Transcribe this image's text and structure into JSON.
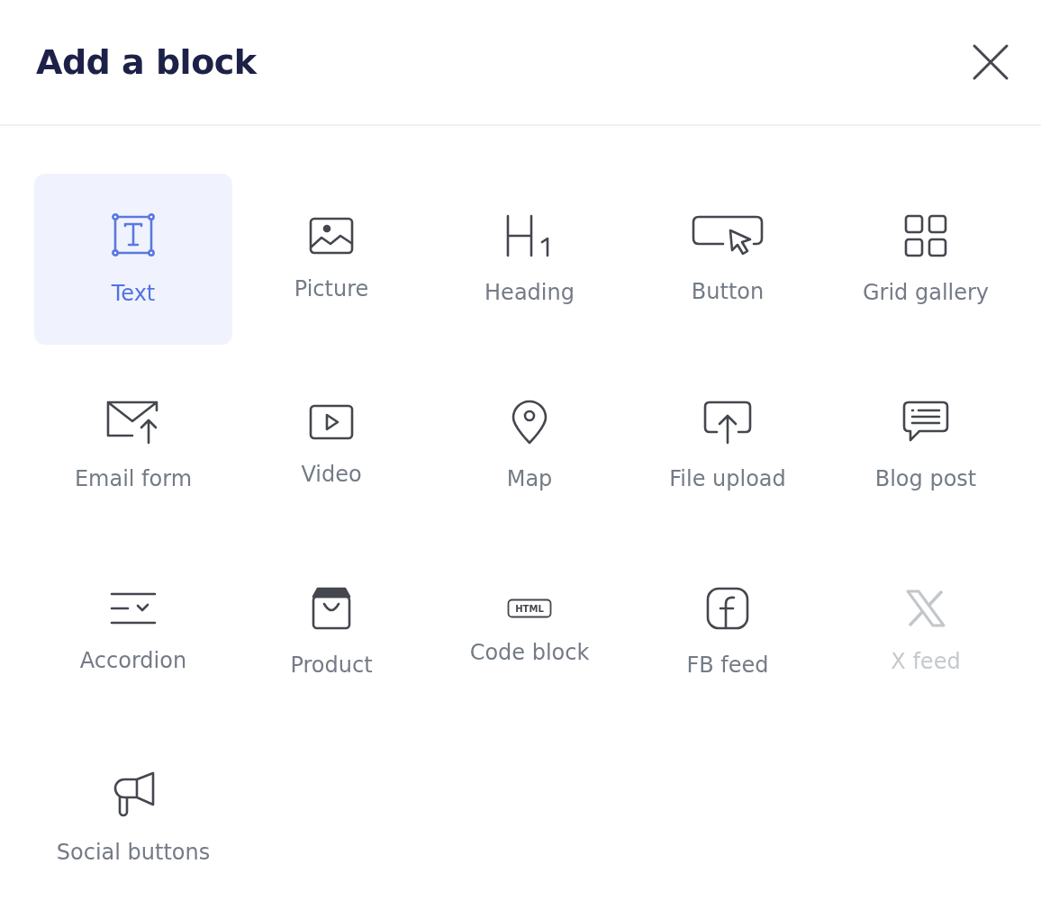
{
  "dialog": {
    "title": "Add a block"
  },
  "blocks": [
    {
      "kind": "text",
      "label": "Text",
      "selected": true,
      "disabled": false
    },
    {
      "kind": "picture",
      "label": "Picture",
      "selected": false,
      "disabled": false
    },
    {
      "kind": "heading",
      "label": "Heading",
      "selected": false,
      "disabled": false
    },
    {
      "kind": "button",
      "label": "Button",
      "selected": false,
      "disabled": false
    },
    {
      "kind": "grid",
      "label": "Grid gallery",
      "selected": false,
      "disabled": false
    },
    {
      "kind": "email",
      "label": "Email form",
      "selected": false,
      "disabled": false
    },
    {
      "kind": "video",
      "label": "Video",
      "selected": false,
      "disabled": false
    },
    {
      "kind": "map",
      "label": "Map",
      "selected": false,
      "disabled": false
    },
    {
      "kind": "upload",
      "label": "File upload",
      "selected": false,
      "disabled": false
    },
    {
      "kind": "blog",
      "label": "Blog post",
      "selected": false,
      "disabled": false
    },
    {
      "kind": "accordion",
      "label": "Accordion",
      "selected": false,
      "disabled": false
    },
    {
      "kind": "product",
      "label": "Product",
      "selected": false,
      "disabled": false
    },
    {
      "kind": "code",
      "label": "Code block",
      "selected": false,
      "disabled": false,
      "icon_text": "HTML"
    },
    {
      "kind": "facebook",
      "label": "FB feed",
      "selected": false,
      "disabled": false
    },
    {
      "kind": "x",
      "label": "X feed",
      "selected": false,
      "disabled": true
    },
    {
      "kind": "social",
      "label": "Social buttons",
      "selected": false,
      "disabled": false
    }
  ]
}
